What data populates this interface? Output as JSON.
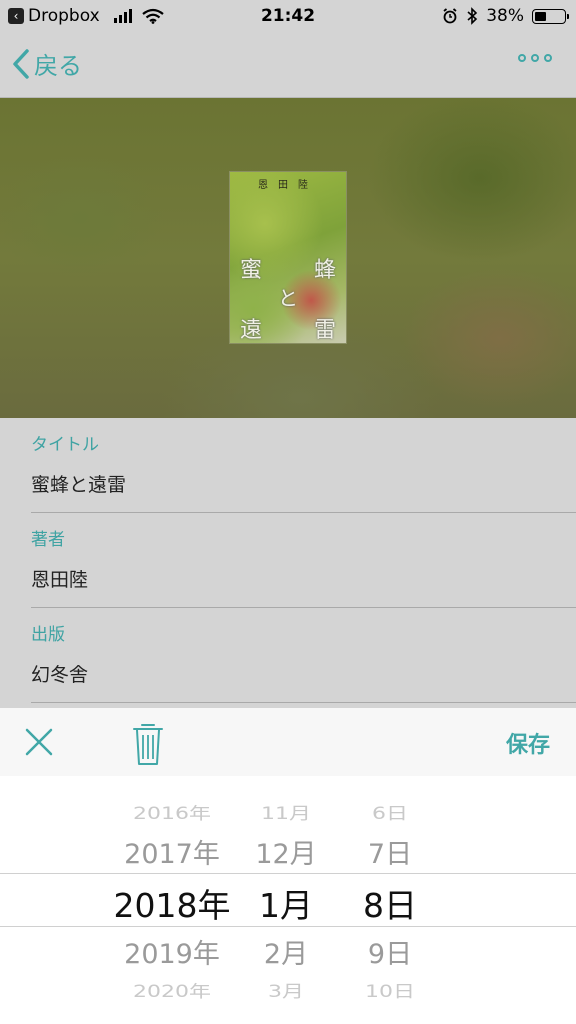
{
  "status_bar": {
    "back_app_label": "Dropbox",
    "time": "21:42",
    "battery_percent": "38%",
    "battery_level": 0.38,
    "icons": [
      "signal-icon",
      "wifi-icon",
      "alarm-icon",
      "bluetooth-icon",
      "battery-icon"
    ]
  },
  "nav": {
    "back_label": "戻る",
    "more_icon": "more-icon",
    "accent_color": "#41a7a7"
  },
  "book": {
    "cover_author": "恩田陸",
    "cover_title_chars": [
      "蜜",
      "蜂",
      "と",
      "遠",
      "雷"
    ]
  },
  "fields": [
    {
      "label": "タイトル",
      "value": "蜜蜂と遠雷"
    },
    {
      "label": "著者",
      "value": "恩田陸"
    },
    {
      "label": "出版",
      "value": "幻冬舎"
    }
  ],
  "toolbar": {
    "close_icon": "close-icon",
    "trash_icon": "trash-icon",
    "save_label": "保存"
  },
  "picker": {
    "years": [
      "2016年",
      "2017年",
      "2018年",
      "2019年",
      "2020年"
    ],
    "months": [
      "11月",
      "12月",
      "1月",
      "2月",
      "3月"
    ],
    "days": [
      "6日",
      "7日",
      "8日",
      "9日",
      "10日"
    ],
    "selected": {
      "year": "2018年",
      "month": "1月",
      "day": "8日"
    }
  }
}
